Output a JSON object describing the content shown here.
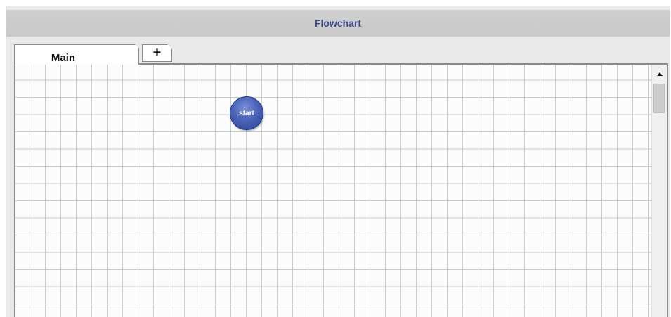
{
  "panel": {
    "title": "Flowchart"
  },
  "tabs": [
    {
      "label": "Main",
      "active": true
    },
    {
      "label": "+",
      "active": false
    }
  ],
  "canvas": {
    "grid": true,
    "nodes": [
      {
        "label": "start",
        "shape": "circle",
        "color": "#3f57ad"
      }
    ]
  },
  "scrollbar": {
    "icon": "arrow-up-icon"
  },
  "colors": {
    "title_text": "#3a4a8c",
    "header_bg": "#cfcfcf",
    "grid_line": "#c5ccd4",
    "node_fill": "#3f57ad"
  }
}
